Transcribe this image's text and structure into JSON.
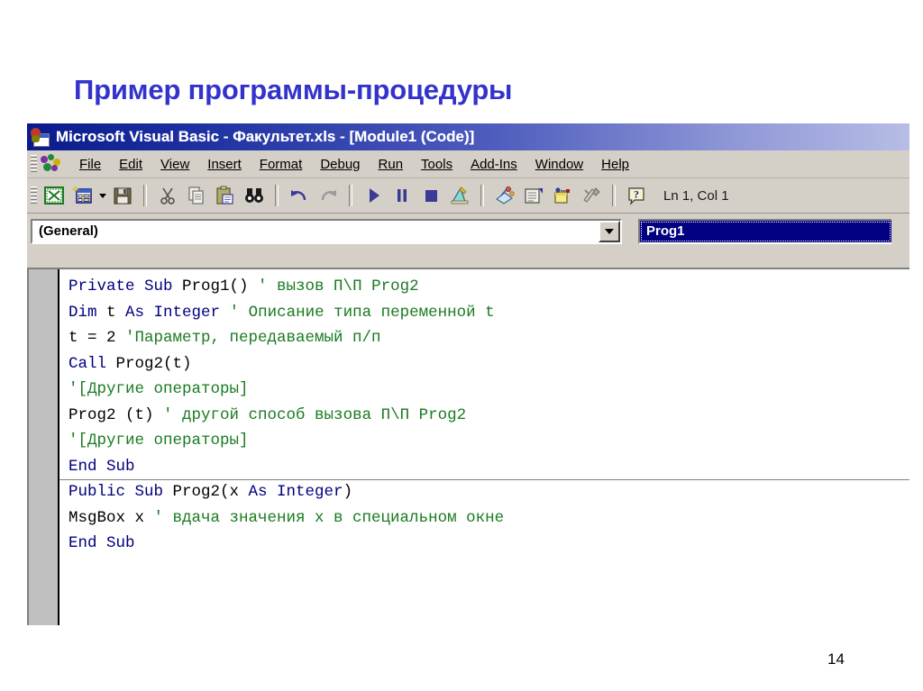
{
  "slide": {
    "title": "Пример программы-процедуры",
    "page_number": "14",
    "title_color": "#3333CC"
  },
  "window": {
    "icon": "excel-vba-icon",
    "title": "Microsoft Visual Basic - Факультет.xls - [Module1 (Code)]",
    "titlebar_gradient_start": "#0A1A8C",
    "titlebar_gradient_end": "#B8BDE6"
  },
  "menubar": {
    "logo_icon": "vba-logo-icon",
    "items": [
      {
        "label": "File",
        "accel": "F"
      },
      {
        "label": "Edit",
        "accel": "E"
      },
      {
        "label": "View",
        "accel": "V"
      },
      {
        "label": "Insert",
        "accel": "I"
      },
      {
        "label": "Format",
        "accel": "o"
      },
      {
        "label": "Debug",
        "accel": "D"
      },
      {
        "label": "Run",
        "accel": "R"
      },
      {
        "label": "Tools",
        "accel": "T"
      },
      {
        "label": "Add-Ins",
        "accel": "A"
      },
      {
        "label": "Window",
        "accel": "W"
      },
      {
        "label": "Help",
        "accel": "H"
      }
    ]
  },
  "toolbar": {
    "buttons": [
      {
        "name": "view-excel-icon",
        "tooltip": "View Microsoft Excel"
      },
      {
        "name": "insert-userform-icon",
        "tooltip": "Insert UserForm"
      },
      {
        "name": "insert-dropdown-icon",
        "tooltip": "Insert"
      },
      {
        "name": "save-icon",
        "tooltip": "Save"
      },
      {
        "name": "cut-icon",
        "tooltip": "Cut"
      },
      {
        "name": "copy-icon",
        "tooltip": "Copy"
      },
      {
        "name": "paste-icon",
        "tooltip": "Paste"
      },
      {
        "name": "find-icon",
        "tooltip": "Find"
      },
      {
        "name": "undo-icon",
        "tooltip": "Undo"
      },
      {
        "name": "redo-icon",
        "tooltip": "Redo"
      },
      {
        "name": "run-icon",
        "tooltip": "Run Sub/UserForm"
      },
      {
        "name": "pause-icon",
        "tooltip": "Break"
      },
      {
        "name": "stop-icon",
        "tooltip": "Reset"
      },
      {
        "name": "design-mode-icon",
        "tooltip": "Design Mode"
      },
      {
        "name": "project-explorer-icon",
        "tooltip": "Project Explorer"
      },
      {
        "name": "properties-window-icon",
        "tooltip": "Properties Window"
      },
      {
        "name": "object-browser-icon",
        "tooltip": "Object Browser"
      },
      {
        "name": "toolbox-icon",
        "tooltip": "Toolbox"
      },
      {
        "name": "help-icon",
        "tooltip": "Microsoft Visual Basic Help"
      }
    ],
    "position_indicator": "Ln 1, Col 1"
  },
  "editor": {
    "object_combo": {
      "value": "(General)",
      "arrow_icon": "chevron-down-icon"
    },
    "procedure_combo": {
      "value": "Prog1",
      "selected": true,
      "highlight_color": "#000080"
    },
    "code_lines": [
      {
        "segments": [
          {
            "t": "Private Sub ",
            "c": "kw"
          },
          {
            "t": "Prog1() ",
            "c": "pl"
          },
          {
            "t": "' вызов П\\П Prog2",
            "c": "cm"
          }
        ]
      },
      {
        "segments": [
          {
            "t": "Dim ",
            "c": "kw"
          },
          {
            "t": "t ",
            "c": "pl"
          },
          {
            "t": "As Integer ",
            "c": "kw"
          },
          {
            "t": "' Описание типа переменной t",
            "c": "cm"
          }
        ]
      },
      {
        "segments": [
          {
            "t": "t = 2 ",
            "c": "pl"
          },
          {
            "t": "'Параметр, передаваемый п/п",
            "c": "cm"
          }
        ]
      },
      {
        "segments": [
          {
            "t": "Call ",
            "c": "kw"
          },
          {
            "t": "Prog2(t)",
            "c": "pl"
          }
        ]
      },
      {
        "segments": [
          {
            "t": "'[Другие операторы]",
            "c": "cm"
          }
        ]
      },
      {
        "segments": [
          {
            "t": "Prog2 (t) ",
            "c": "pl"
          },
          {
            "t": "' другой способ вызова П\\П Prog2",
            "c": "cm"
          }
        ]
      },
      {
        "segments": [
          {
            "t": "'[Другие операторы]",
            "c": "cm"
          }
        ]
      },
      {
        "segments": [
          {
            "t": "End Sub",
            "c": "kw"
          }
        ],
        "separator_after": true
      },
      {
        "segments": [
          {
            "t": "Public Sub ",
            "c": "kw"
          },
          {
            "t": "Prog2(x ",
            "c": "pl"
          },
          {
            "t": "As Integer",
            "c": "kw"
          },
          {
            "t": ")",
            "c": "pl"
          }
        ]
      },
      {
        "segments": [
          {
            "t": "MsgBox x ",
            "c": "pl"
          },
          {
            "t": "' вдача значения x в специальном окне",
            "c": "cm"
          }
        ]
      },
      {
        "segments": [
          {
            "t": "End Sub",
            "c": "kw"
          }
        ]
      }
    ],
    "colors": {
      "keyword": "#00007F",
      "comment": "#1A7A20",
      "plain": "#000000",
      "background": "#FFFFFF",
      "gutter": "#C0C0C0"
    }
  }
}
